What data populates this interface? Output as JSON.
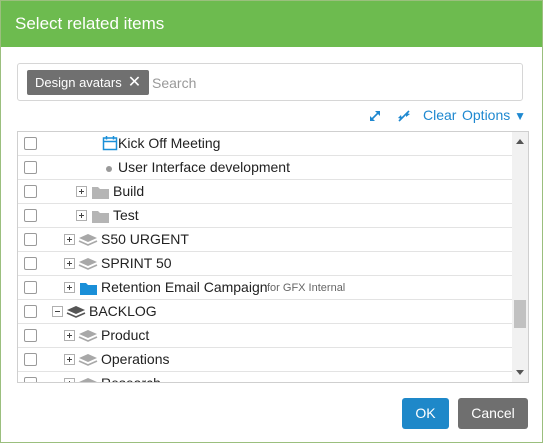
{
  "dialog": {
    "title": "Select related items",
    "header_color": "#6dbb4f"
  },
  "search": {
    "chip_label": "Design avatars",
    "chip_remove_icon": "close-icon",
    "placeholder": "Search"
  },
  "toolbar": {
    "expand_icon": "expand-arrows-icon",
    "collapse_icon": "collapse-arrows-icon",
    "clear_label": "Clear",
    "options_label": "Options"
  },
  "tree": {
    "rows": [
      {
        "label": "Kick Off Meeting",
        "icon": "calendar-icon"
      },
      {
        "label": "User Interface development",
        "icon": "bullet-icon"
      },
      {
        "label": "Build",
        "icon": "folder-icon"
      },
      {
        "label": "Test",
        "icon": "folder-icon"
      },
      {
        "label": "S50 URGENT",
        "icon": "layers-icon"
      },
      {
        "label": "SPRINT 50",
        "icon": "layers-icon"
      },
      {
        "label": "Retention Email Campaign",
        "icon": "folder-icon",
        "sublabel": "for GFX Internal"
      },
      {
        "label": "BACKLOG",
        "icon": "layers-icon"
      },
      {
        "label": "Product",
        "icon": "layers-icon"
      },
      {
        "label": "Operations",
        "icon": "layers-icon"
      },
      {
        "label": "Research",
        "icon": "layers-icon"
      }
    ]
  },
  "buttons": {
    "ok_label": "OK",
    "cancel_label": "Cancel"
  },
  "colors": {
    "link": "#1e88d0",
    "ok_button": "#1e88c9",
    "cancel_button": "#6f6f6f",
    "chip": "#707070",
    "folder_blue": "#1a8fd8",
    "folder_gray": "#b5b5b5"
  }
}
